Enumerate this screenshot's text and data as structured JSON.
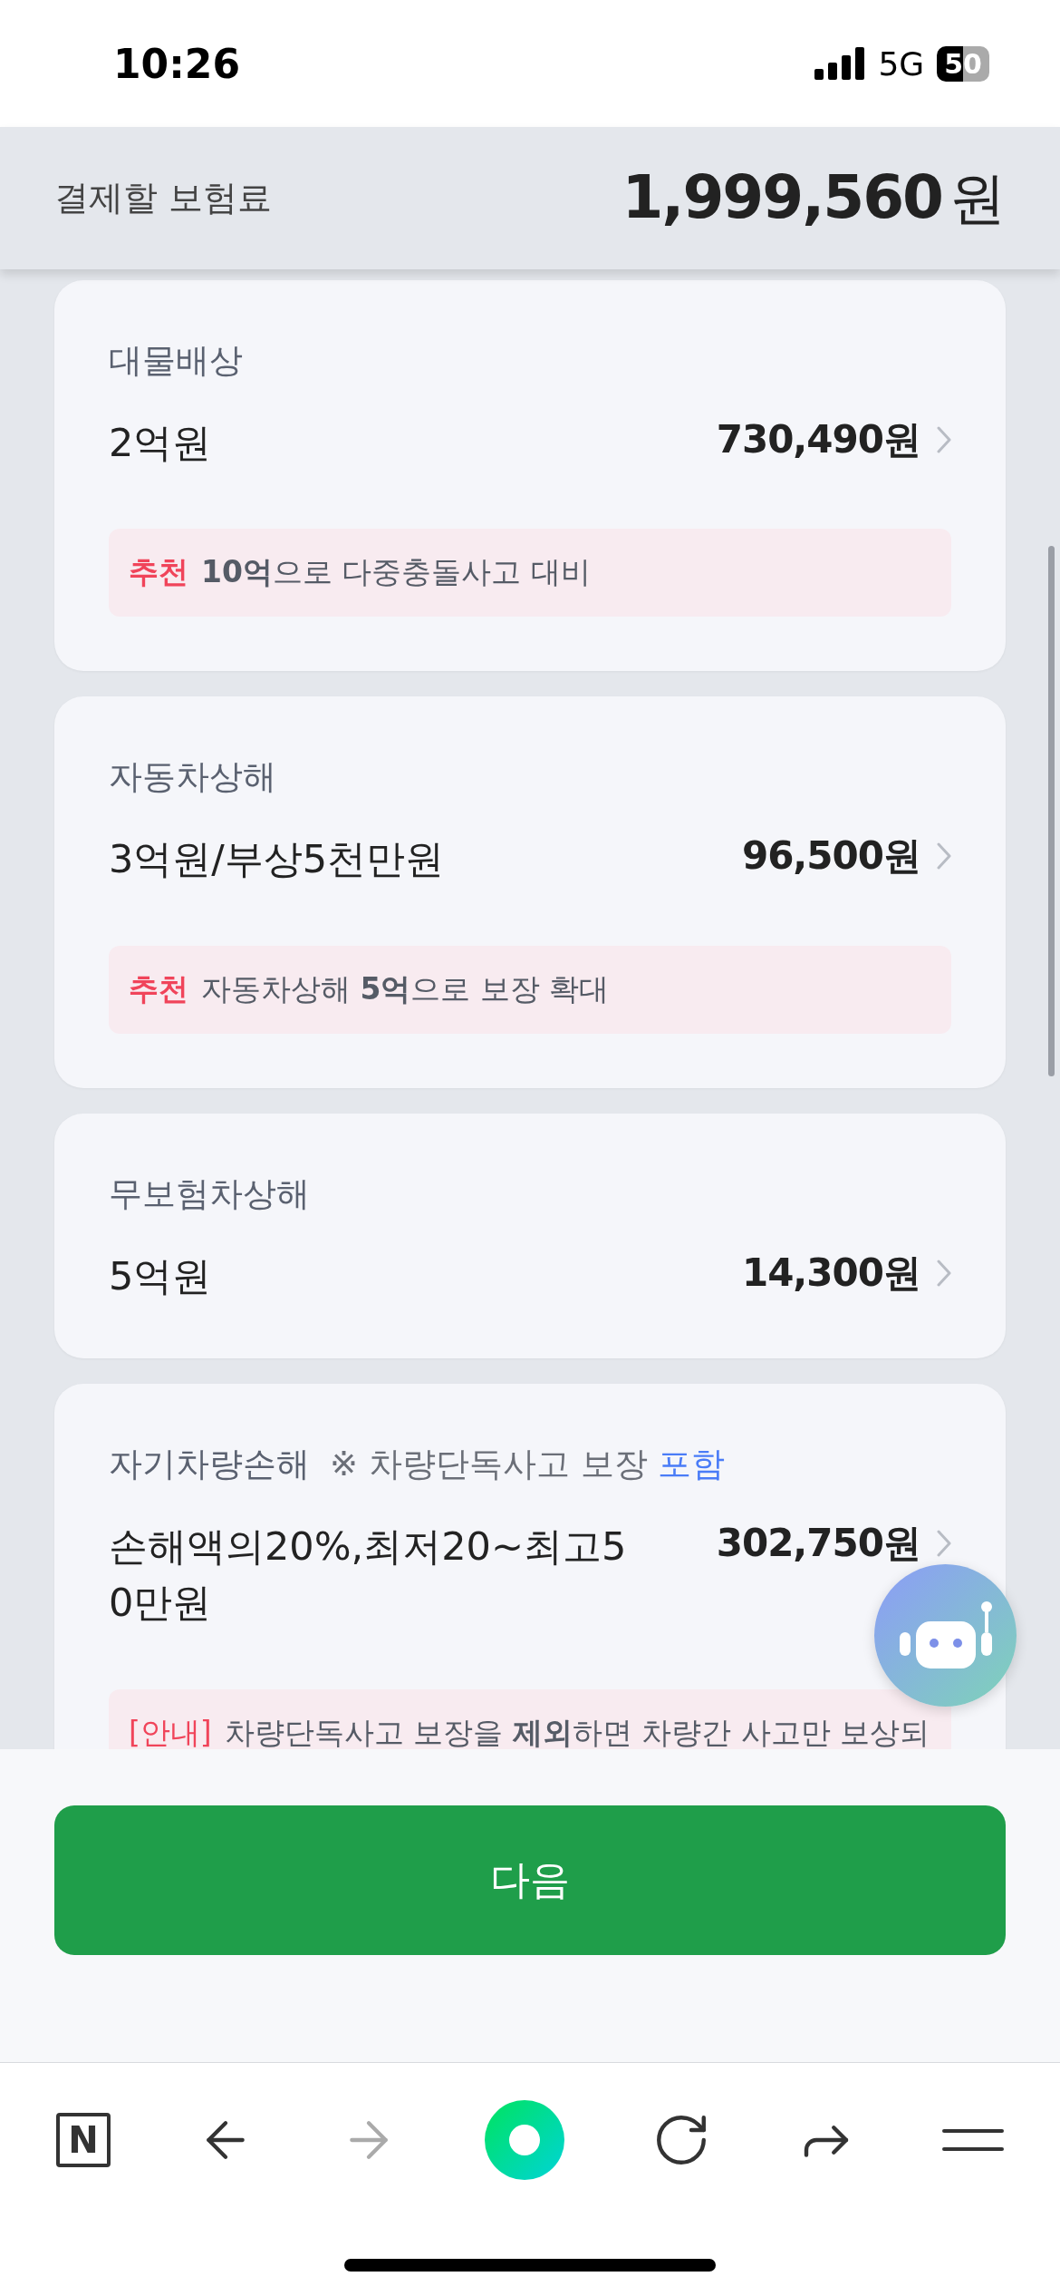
{
  "status_bar": {
    "time": "10:26",
    "network": "5G",
    "battery": "50"
  },
  "header": {
    "label": "결제할 보험료",
    "amount": "1,999,560",
    "unit": "원"
  },
  "cards": [
    {
      "label": "대물배상",
      "value": "2억원",
      "price": "730,490원",
      "tip": {
        "kind": "recommend",
        "tag": "추천",
        "text": "**10억**으로 다중충돌사고 대비"
      }
    },
    {
      "label": "자동차상해",
      "value": "3억원/부상5천만원",
      "price": "96,500원",
      "tip": {
        "kind": "recommend",
        "tag": "추천",
        "text": "자동차상해 **5억**으로 보장 확대"
      }
    },
    {
      "label": "무보험차상해",
      "value": "5억원",
      "price": "14,300원"
    },
    {
      "label": "자기차량손해",
      "note": "※ 차량단독사고 보장",
      "note_highlight": "포함",
      "value": "손해액의20%,최저20~최고5\n0만원",
      "price": "302,750원",
      "tip": {
        "kind": "notice",
        "tag": "[안내]",
        "text": "차량단독사고 보장을 **제외**하면 차량간 사고만 보상되"
      }
    }
  ],
  "next_button": "다음",
  "browser_bar": {
    "home_label": "N",
    "forward_disabled": true
  }
}
